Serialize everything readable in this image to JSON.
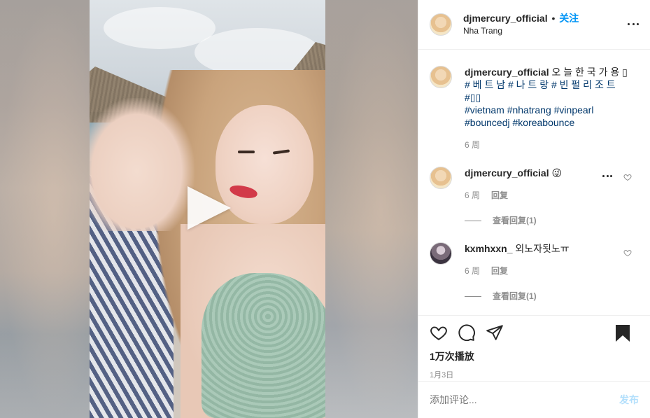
{
  "post": {
    "username": "djmercury_official",
    "separator": "•",
    "follow_label": "关注",
    "location": "Nha Trang"
  },
  "caption": {
    "username": "djmercury_official",
    "line1": "오 늘 한 국 가 용 ▯",
    "line2": "# 베 트 남 # 나 트 랑 # 빈 펄 리 조 트",
    "line3": "#▯▯",
    "tags_line1": "#vietnam #nhatrang #vinpearl",
    "tags_line2": "#bouncedj #koreabounce",
    "time": "6 周"
  },
  "comments": [
    {
      "username": "djmercury_official",
      "text": "😜",
      "time": "6 周",
      "reply_label": "回复",
      "view_replies": "查看回复(1)"
    },
    {
      "username": "kxmhxxn_",
      "text": "외노자됫노ㅠ",
      "time": "6 周",
      "reply_label": "回复",
      "view_replies": "查看回复(1)"
    }
  ],
  "stats": {
    "views": "1万次播放",
    "date": "1月3日"
  },
  "comment_box": {
    "placeholder": "添加评论...",
    "post_label": "发布"
  },
  "colors": {
    "link": "#0095f6",
    "hashtag": "#00376b",
    "muted": "#8e8e8e",
    "post_disabled": "#b2dffc"
  },
  "icons": {
    "play": "play-icon",
    "more": "more-icon",
    "like": "heart-icon",
    "comment": "comment-icon",
    "share": "paper-plane-icon",
    "save": "bookmark-icon"
  }
}
